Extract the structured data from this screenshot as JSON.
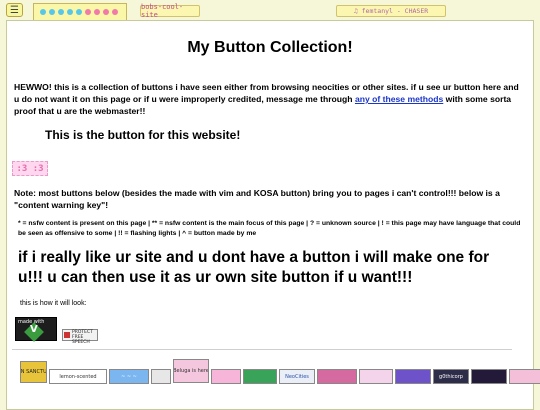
{
  "topbar": {
    "menu_icon": "☰",
    "site_tag": "bobs-cool-site",
    "music": "♫ femtanyl - CHASER",
    "dot_colors": [
      "#58c6e8",
      "#58c6e8",
      "#58c6e8",
      "#58c6e8",
      "#58c6e8",
      "#f07aa8",
      "#f07aa8",
      "#f07aa8",
      "#f07aa8"
    ]
  },
  "main": {
    "title": "My Button Collection!",
    "intro_text": "HEWWO! this is a collection of buttons i have seen either from browsing neocities or other sites. if u see ur button here and u do not want it on this page or if u were improperly credited, message me through ",
    "intro_link": "any of these methods",
    "intro_tail": " with some sorta proof that u are the webmaster!!",
    "site_button_heading": "This is the button for this website!",
    "site_button_label": ":3 :3",
    "note": "Note: most buttons below (besides the made with vim and KOSA button) bring you to pages i can't control!!! below is a \"content warning key\"!",
    "legend": "* = nsfw content is present on this page | ** = nsfw content is the main focus of this page | ? = unknown source | ! = this page may have language that could be seen as offensive to some | !! = flashing lights | ^ = button made by me",
    "big_text": "if i really like ur site and u dont have a button i will make one for u!!! u can then use it as ur own site button if u want!!!",
    "how_it_looks": "this is how it will look:",
    "vim_button_text": "made with",
    "vim_letter": "V",
    "pfs_button_text": "PROTECT FREE SPEECH"
  },
  "button_row": [
    {
      "label": "EDEN SANCTUARY",
      "color": "#e8c43a",
      "text": "#222"
    },
    {
      "label": "lemon-scented",
      "color": "#ffffff",
      "text": "#333"
    },
    {
      "label": "~ ~ ~",
      "color": "#7bb6f0",
      "text": "#fff"
    },
    {
      "label": "",
      "color": "#e7e7e7",
      "text": "#333"
    },
    {
      "label": "Beluga is here",
      "color": "#f4c7df",
      "text": "#333"
    },
    {
      "label": "",
      "color": "#f7b6d9",
      "text": "#333"
    },
    {
      "label": "",
      "color": "#3aa35a",
      "text": "#fff"
    },
    {
      "label": "NeoCities",
      "color": "#e9eef7",
      "text": "#2c4fa8"
    },
    {
      "label": "",
      "color": "#d46aa0",
      "text": "#fff"
    },
    {
      "label": "",
      "color": "#f4d4ea",
      "text": "#333"
    },
    {
      "label": "",
      "color": "#6d52c9",
      "text": "#fff"
    },
    {
      "label": "g0thicorp",
      "color": "#2d2d4a",
      "text": "#fff"
    },
    {
      "label": "",
      "color": "#231a3a",
      "text": "#fff"
    },
    {
      "label": "",
      "color": "#f4bfd8",
      "text": "#333"
    }
  ]
}
